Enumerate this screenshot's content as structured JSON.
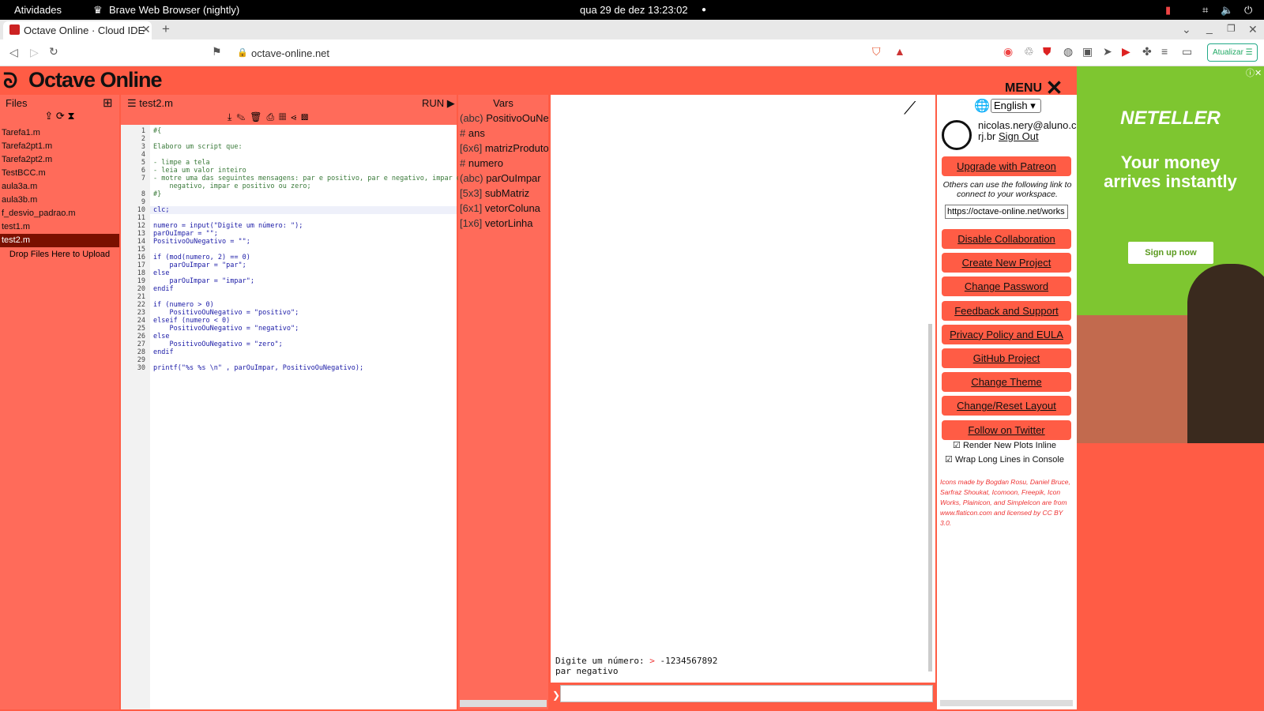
{
  "os": {
    "activities": "Atividades",
    "app_name": "Brave Web Browser (nightly)",
    "datetime": "qua 29 de dez  13:23:02"
  },
  "browser": {
    "tab_title": "Octave Online · Cloud IDE",
    "url": "octave-online.net",
    "update_label": "Atualizar"
  },
  "app": {
    "brand": "Octave Online",
    "menu_label": "MENU"
  },
  "files": {
    "header": "Files",
    "items": [
      "Tarefa1.m",
      "Tarefa2pt1.m",
      "Tarefa2pt2.m",
      "TestBCC.m",
      "aula3a.m",
      "aula3b.m",
      "f_desvio_padrao.m",
      "test1.m",
      "test2.m"
    ],
    "selected_index": 8,
    "drop_label": "Drop Files Here to Upload"
  },
  "editor": {
    "filename": "test2.m",
    "run_label": "RUN ▶",
    "lines": [
      "#{",
      "",
      "Elaboro um script que:",
      "",
      "- limpe a tela",
      "- leia um valor inteiro",
      "- motre uma das seguintes mensagens: par e positivo, par e negativo, impar e",
      "    negativo, impar e positivo ou zero;",
      "#}",
      "",
      "clc;",
      "",
      "numero = input(\"Digite um número: \");",
      "parOuImpar = \"\";",
      "PositivoOuNegativo = \"\";",
      "",
      "if (mod(numero, 2) == 0)",
      "    parOuImpar = \"par\";",
      "else",
      "    parOuImpar = \"impar\";",
      "endif",
      "",
      "if (numero > 0)",
      "    PositivoOuNegativo = \"positivo\";",
      "elseif (numero < 0)",
      "    PositivoOuNegativo = \"negativo\";",
      "else",
      "    PositivoOuNegativo = \"zero\";",
      "endif",
      "",
      "printf(\"%s %s \\n\" , parOuImpar, PositivoOuNegativo);"
    ],
    "line_numbers": [
      "1",
      "2",
      "3",
      "4",
      "5",
      "6",
      "7",
      "",
      "8",
      "9",
      "10",
      "11",
      "12",
      "13",
      "14",
      "15",
      "16",
      "17",
      "18",
      "19",
      "20",
      "21",
      "22",
      "23",
      "24",
      "25",
      "26",
      "27",
      "28",
      "29",
      "30",
      "31"
    ]
  },
  "vars": {
    "header": "Vars",
    "items": [
      {
        "type": "(abc)",
        "name": "PositivoOuNe"
      },
      {
        "type": "#",
        "name": "ans"
      },
      {
        "type": "[6x6]",
        "name": "matrizProduto"
      },
      {
        "type": "#",
        "name": "numero"
      },
      {
        "type": "(abc)",
        "name": "parOuImpar"
      },
      {
        "type": "[5x3]",
        "name": "subMatriz"
      },
      {
        "type": "[6x1]",
        "name": "vetorColuna"
      },
      {
        "type": "[1x6]",
        "name": "vetorLinha"
      }
    ]
  },
  "console": {
    "prompt_text": "Digite um número: ",
    "prompt_marker": ">",
    "input_value": "-1234567892",
    "output": "par negativo"
  },
  "side": {
    "language": "English",
    "email_line1": "nicolas.nery@aluno.c",
    "email_line2": "rj.br",
    "sign_out": "Sign Out",
    "patreon": "Upgrade with Patreon",
    "share_note": "Others can use the following link to connect to your workspace.",
    "share_link": "https://octave-online.net/works",
    "buttons": [
      "Disable Collaboration",
      "Create New Project",
      "Change Password",
      "Feedback and Support",
      "Privacy Policy and EULA",
      "GitHub Project",
      "Change Theme",
      "Change/Reset Layout",
      "Follow on Twitter"
    ],
    "check1": "Render New Plots Inline",
    "check2": "Wrap Long Lines in Console",
    "credits": "Icons made by Bogdan Rosu, Daniel Bruce, Sarfraz Shoukat, Icomoon, Freepik, Icon Works, Plainicon, and SimpleIcon are from www.flaticon.com and licensed by CC BY 3.0."
  },
  "ad": {
    "brand": "NETELLER",
    "headline": "Your money arrives instantly",
    "cta": "Sign up now"
  }
}
